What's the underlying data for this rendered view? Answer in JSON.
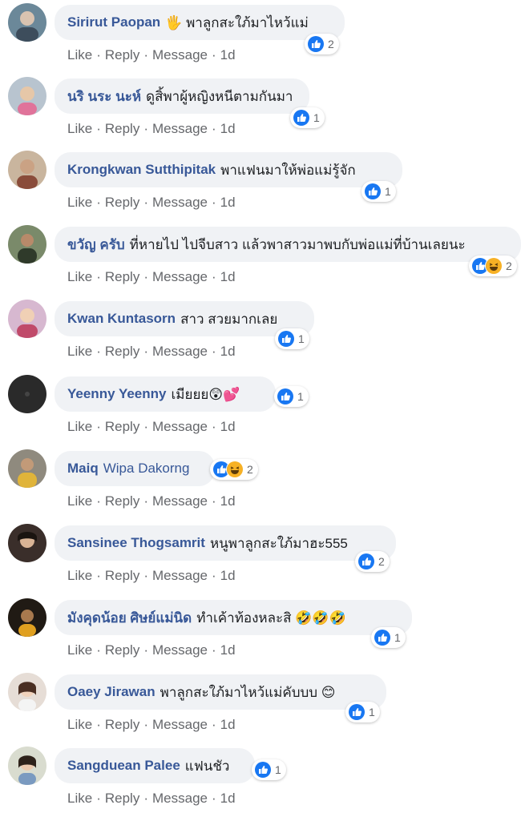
{
  "actions": {
    "like": "Like",
    "reply": "Reply",
    "message": "Message",
    "sep": "·"
  },
  "comments": [
    {
      "author": "Sirirut Paopan",
      "text": "🖐 พาลูกสะใภ้มาไหว้แม่",
      "reaction_count": "2",
      "time": "1d",
      "reactions": [
        "like"
      ]
    },
    {
      "author": "นริ นระ นะห์",
      "text": "ดูสิ้พาผู้หญิงหนีตามกันมา",
      "reaction_count": "1",
      "time": "1d",
      "reactions": [
        "like"
      ]
    },
    {
      "author": "Krongkwan Sutthipitak",
      "text": "พาแฟนมาให้พ่อแม่รู้จัก",
      "reaction_count": "1",
      "time": "1d",
      "reactions": [
        "like"
      ]
    },
    {
      "author": "ขวัญ ครับ",
      "text": "ที่หายไป ไปจีบสาว แล้วพาสาวมาพบกับพ่อแม่ที่บ้านเลยนะ",
      "reaction_count": "2",
      "time": "1d",
      "reactions": [
        "like",
        "haha"
      ]
    },
    {
      "author": "Kwan Kuntasorn",
      "text": "สาว สวยมากเลย",
      "reaction_count": "1",
      "time": "1d",
      "reactions": [
        "like"
      ]
    },
    {
      "author": "Yeenny Yeenny",
      "text": "เมียยย😲💕",
      "reaction_count": "1",
      "time": "1d",
      "reactions": [
        "like"
      ]
    },
    {
      "author": "Maiq",
      "author2": "Wipa Dakorng",
      "text": "",
      "reaction_count": "2",
      "time": "1d",
      "reactions": [
        "like",
        "haha"
      ]
    },
    {
      "author": "Sansinee Thogsamrit",
      "text": "หนูพาลูกสะใภ้มาฮะ555",
      "reaction_count": "2",
      "time": "1d",
      "reactions": [
        "like"
      ]
    },
    {
      "author": "มังคุดน้อย ศิษย์แม่นิด",
      "text": "ทำเค้าท้องหละสิ 🤣🤣🤣",
      "reaction_count": "1",
      "time": "1d",
      "reactions": [
        "like"
      ]
    },
    {
      "author": "Oaey Jirawan",
      "text": "พาลูกสะใภ้มาไหว้แม่คับบบ 😊",
      "reaction_count": "1",
      "time": "1d",
      "reactions": [
        "like"
      ]
    },
    {
      "author": "Sangduean Palee",
      "text": "แฟนชัว",
      "reaction_count": "1",
      "time": "1d",
      "reactions": [
        "like"
      ]
    }
  ],
  "colors": {
    "link": "#385898",
    "bubble": "#f0f2f5",
    "like": "#1877f2",
    "haha": "#f7b125",
    "meta": "#65676b"
  }
}
